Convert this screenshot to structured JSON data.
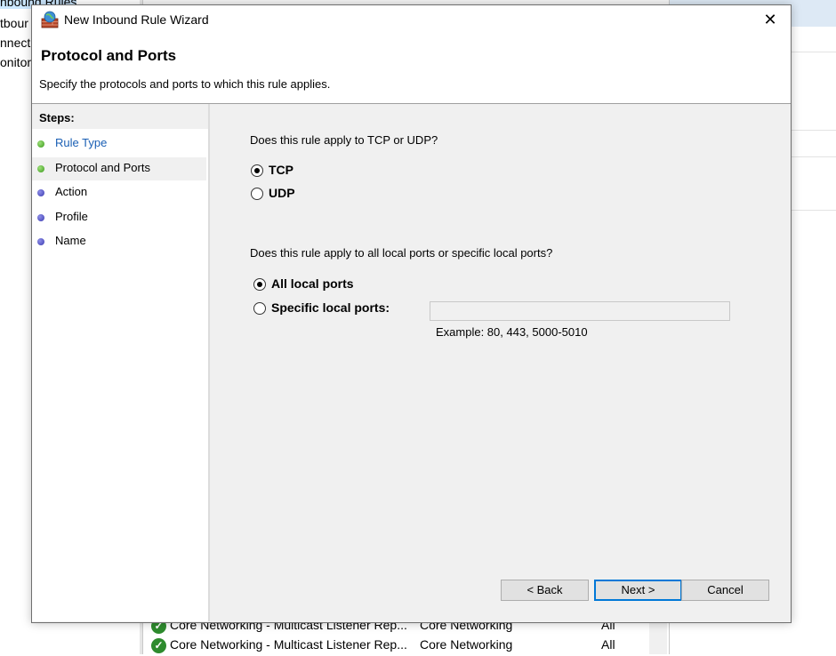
{
  "background": {
    "tree_items": [
      "nbound Rules",
      "tbour",
      "nnect",
      "onitor"
    ],
    "list_rows": [
      {
        "name": "Core Networking - Multicast Listener Rep...",
        "group": "Core Networking",
        "profile": "All"
      },
      {
        "name": "Core Networking - Multicast Listener Rep...",
        "group": "Core Networking",
        "profile": "All"
      }
    ]
  },
  "dialog": {
    "title": "New Inbound Rule Wizard",
    "close_glyph": "✕",
    "header_title": "Protocol and Ports",
    "header_subtitle": "Specify the protocols and ports to which this rule applies.",
    "steps_title": "Steps:",
    "steps": [
      {
        "label": "Rule Type",
        "status": "done"
      },
      {
        "label": "Protocol and Ports",
        "status": "current"
      },
      {
        "label": "Action",
        "status": "pending"
      },
      {
        "label": "Profile",
        "status": "pending"
      },
      {
        "label": "Name",
        "status": "pending"
      }
    ],
    "protocol_question": "Does this rule apply to TCP or UDP?",
    "protocol_options": [
      {
        "label": "TCP",
        "checked": true
      },
      {
        "label": "UDP",
        "checked": false
      }
    ],
    "ports_question": "Does this rule apply to all local ports or specific local ports?",
    "port_options": [
      {
        "label": "All local ports",
        "checked": true
      },
      {
        "label": "Specific local ports:",
        "checked": false
      }
    ],
    "port_input_value": "",
    "port_example": "Example: 80, 443, 5000-5010",
    "buttons": {
      "back": "< Back",
      "next": "Next >",
      "cancel": "Cancel"
    }
  },
  "colors": {
    "link": "#1a5fb4",
    "done_dot": "#3a9a1c",
    "pending_dot": "#3b3bb0",
    "default_button": "#0078d7"
  }
}
